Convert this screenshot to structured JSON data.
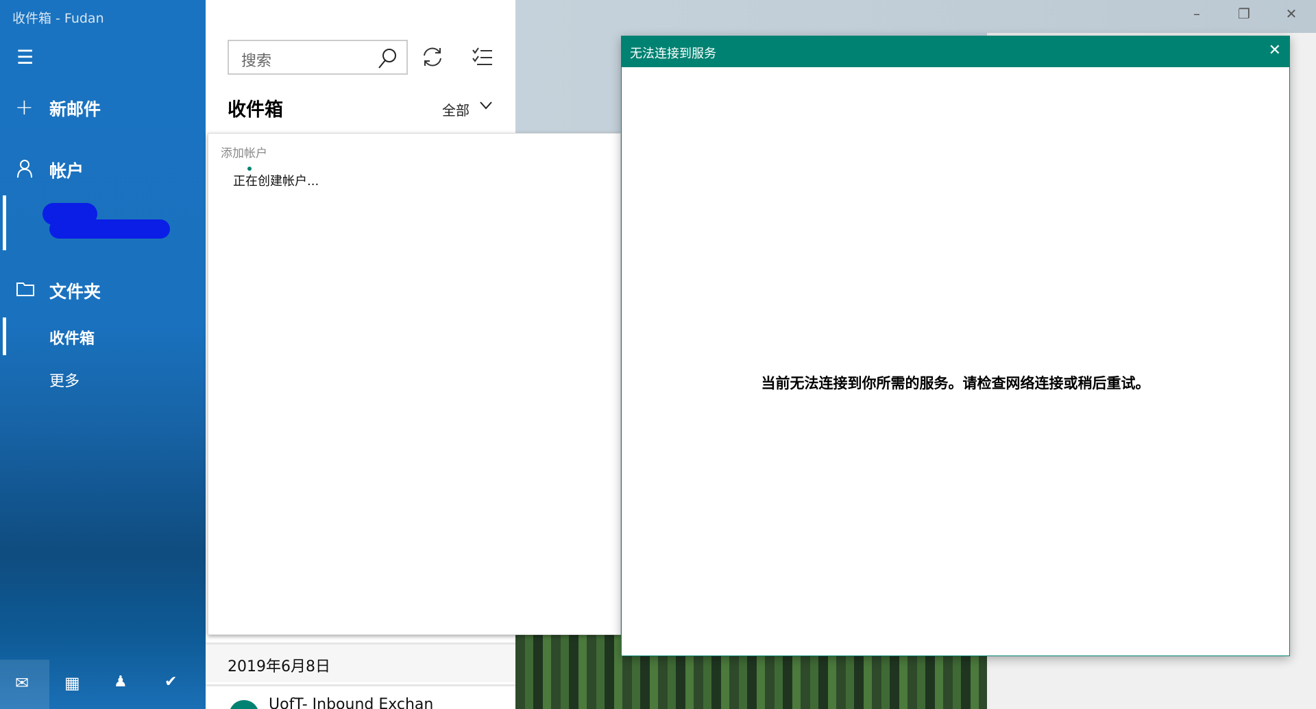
{
  "window": {
    "title": "收件箱 - Fudan",
    "minimize_icon": "minimize-icon",
    "restore_icon": "restore-icon",
    "close_icon": "close-icon"
  },
  "sidebar": {
    "menu_icon": "hamburger-icon",
    "new_mail": "新邮件",
    "accounts": "帐户",
    "folders": "文件夹",
    "folder_items": [
      {
        "label": "收件箱",
        "selected": true
      },
      {
        "label": "更多"
      }
    ],
    "bottom_icons": [
      "mail-icon",
      "calendar-icon",
      "people-icon",
      "todo-icon"
    ]
  },
  "list": {
    "search_placeholder": "搜索",
    "header": "收件箱",
    "filter": "全部",
    "date_group": "2019年6月8日",
    "first_item_sender": "UofT- Inbound Exchan"
  },
  "add_account": {
    "title": "添加帐户",
    "status": "正在创建帐户..."
  },
  "dialog": {
    "title": "无法连接到服务",
    "message": "当前无法连接到你所需的服务。请检查网络连接或稍后重试。",
    "accent": "#008272"
  },
  "colors": {
    "sidebar": "#1a73c0",
    "accent": "#008272"
  }
}
